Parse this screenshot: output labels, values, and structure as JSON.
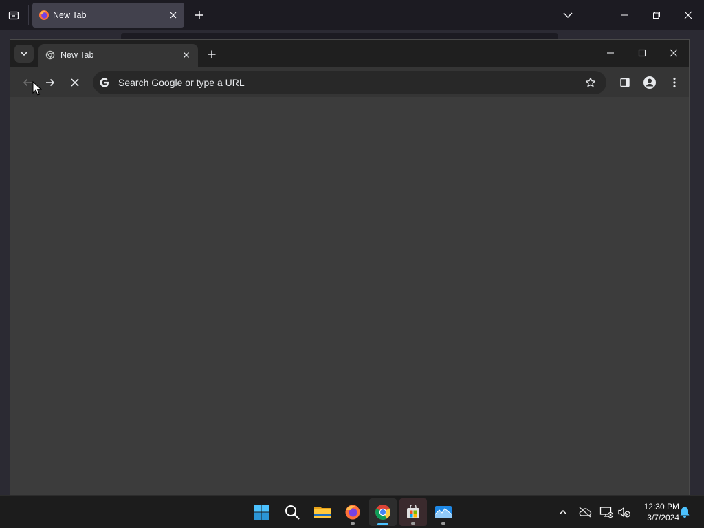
{
  "firefox": {
    "tab_title": "New Tab"
  },
  "chrome": {
    "tab_title": "New Tab",
    "omnibox_placeholder": "Search Google or type a URL"
  },
  "taskbar": {
    "apps": [
      "start",
      "search",
      "file-explorer",
      "firefox",
      "chrome",
      "microsoft-store",
      "app"
    ],
    "active_app": "chrome",
    "time": "12:30 PM",
    "date": "3/7/2024"
  },
  "colors": {
    "firefox_bg": "#1c1b22",
    "chrome_content_bg": "#3c3c3c",
    "taskbar_bg": "#1c1c1c",
    "accent": "#4cc2ff"
  }
}
